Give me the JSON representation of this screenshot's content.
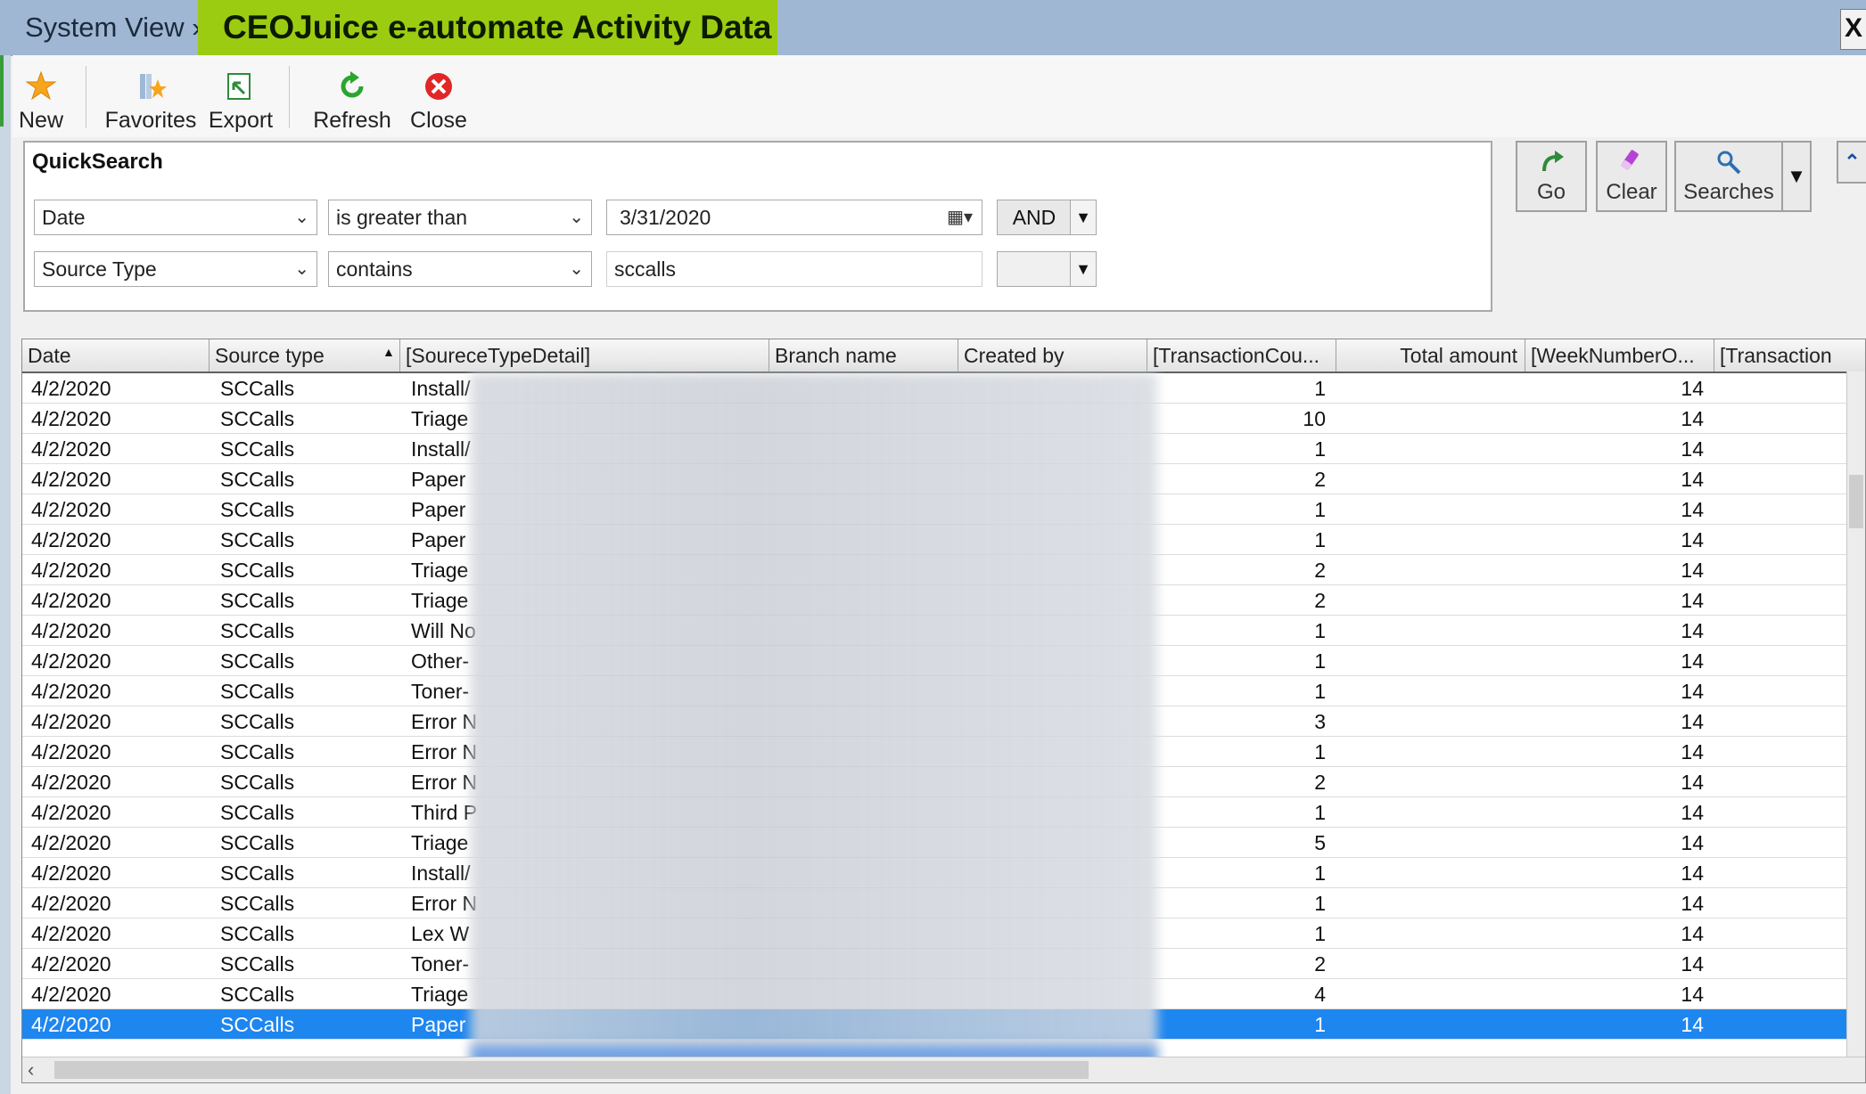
{
  "window": {
    "breadcrumb": "System View »",
    "title": "CEOJuice e-automate Activity Data",
    "close_glyph": "X"
  },
  "toolbar": {
    "new": "New",
    "favorites": "Favorites",
    "export": "Export",
    "refresh": "Refresh",
    "close": "Close"
  },
  "quicksearch": {
    "title": "QuickSearch",
    "row1": {
      "field": "Date",
      "operator": "is greater than",
      "value": "3/31/2020",
      "conjunction": "AND"
    },
    "row2": {
      "field": "Source Type",
      "operator": "contains",
      "value": "sccalls",
      "conjunction": ""
    }
  },
  "actions": {
    "go": "Go",
    "clear": "Clear",
    "searches": "Searches"
  },
  "grid": {
    "columns": [
      "Date",
      "Source type",
      "[SoureceTypeDetail]",
      "Branch name",
      "Created by",
      "[TransactionCou...",
      "Total amount",
      "[WeekNumberO...",
      "[Transaction"
    ],
    "rows": [
      {
        "date": "4/2/2020",
        "source": "SCCalls",
        "detail": "Install/",
        "count": "1",
        "week": "14"
      },
      {
        "date": "4/2/2020",
        "source": "SCCalls",
        "detail": "Triage",
        "count": "10",
        "week": "14"
      },
      {
        "date": "4/2/2020",
        "source": "SCCalls",
        "detail": "Install/",
        "count": "1",
        "week": "14"
      },
      {
        "date": "4/2/2020",
        "source": "SCCalls",
        "detail": "Paper",
        "count": "2",
        "week": "14"
      },
      {
        "date": "4/2/2020",
        "source": "SCCalls",
        "detail": "Paper",
        "count": "1",
        "week": "14"
      },
      {
        "date": "4/2/2020",
        "source": "SCCalls",
        "detail": "Paper",
        "count": "1",
        "week": "14"
      },
      {
        "date": "4/2/2020",
        "source": "SCCalls",
        "detail": "Triage",
        "count": "2",
        "week": "14"
      },
      {
        "date": "4/2/2020",
        "source": "SCCalls",
        "detail": "Triage",
        "count": "2",
        "week": "14"
      },
      {
        "date": "4/2/2020",
        "source": "SCCalls",
        "detail": "Will No",
        "count": "1",
        "week": "14"
      },
      {
        "date": "4/2/2020",
        "source": "SCCalls",
        "detail": "Other-",
        "count": "1",
        "week": "14"
      },
      {
        "date": "4/2/2020",
        "source": "SCCalls",
        "detail": "Toner-",
        "count": "1",
        "week": "14"
      },
      {
        "date": "4/2/2020",
        "source": "SCCalls",
        "detail": "Error N",
        "count": "3",
        "week": "14"
      },
      {
        "date": "4/2/2020",
        "source": "SCCalls",
        "detail": "Error N",
        "count": "1",
        "week": "14"
      },
      {
        "date": "4/2/2020",
        "source": "SCCalls",
        "detail": "Error N",
        "count": "2",
        "week": "14"
      },
      {
        "date": "4/2/2020",
        "source": "SCCalls",
        "detail": "Third P",
        "count": "1",
        "week": "14"
      },
      {
        "date": "4/2/2020",
        "source": "SCCalls",
        "detail": "Triage",
        "count": "5",
        "week": "14"
      },
      {
        "date": "4/2/2020",
        "source": "SCCalls",
        "detail": "Install/",
        "count": "1",
        "week": "14"
      },
      {
        "date": "4/2/2020",
        "source": "SCCalls",
        "detail": "Error N",
        "count": "1",
        "week": "14"
      },
      {
        "date": "4/2/2020",
        "source": "SCCalls",
        "detail": "Lex W",
        "count": "1",
        "week": "14"
      },
      {
        "date": "4/2/2020",
        "source": "SCCalls",
        "detail": "Toner-",
        "count": "2",
        "week": "14"
      },
      {
        "date": "4/2/2020",
        "source": "SCCalls",
        "detail": "Triage",
        "count": "4",
        "week": "14"
      },
      {
        "date": "4/2/2020",
        "source": "SCCalls",
        "detail": "Paper",
        "count": "1",
        "week": "14",
        "selected": true
      }
    ]
  },
  "colors": {
    "title_accent": "#9ccc12",
    "titlebar": "#9fb7d3",
    "selection": "#1e86ef"
  }
}
